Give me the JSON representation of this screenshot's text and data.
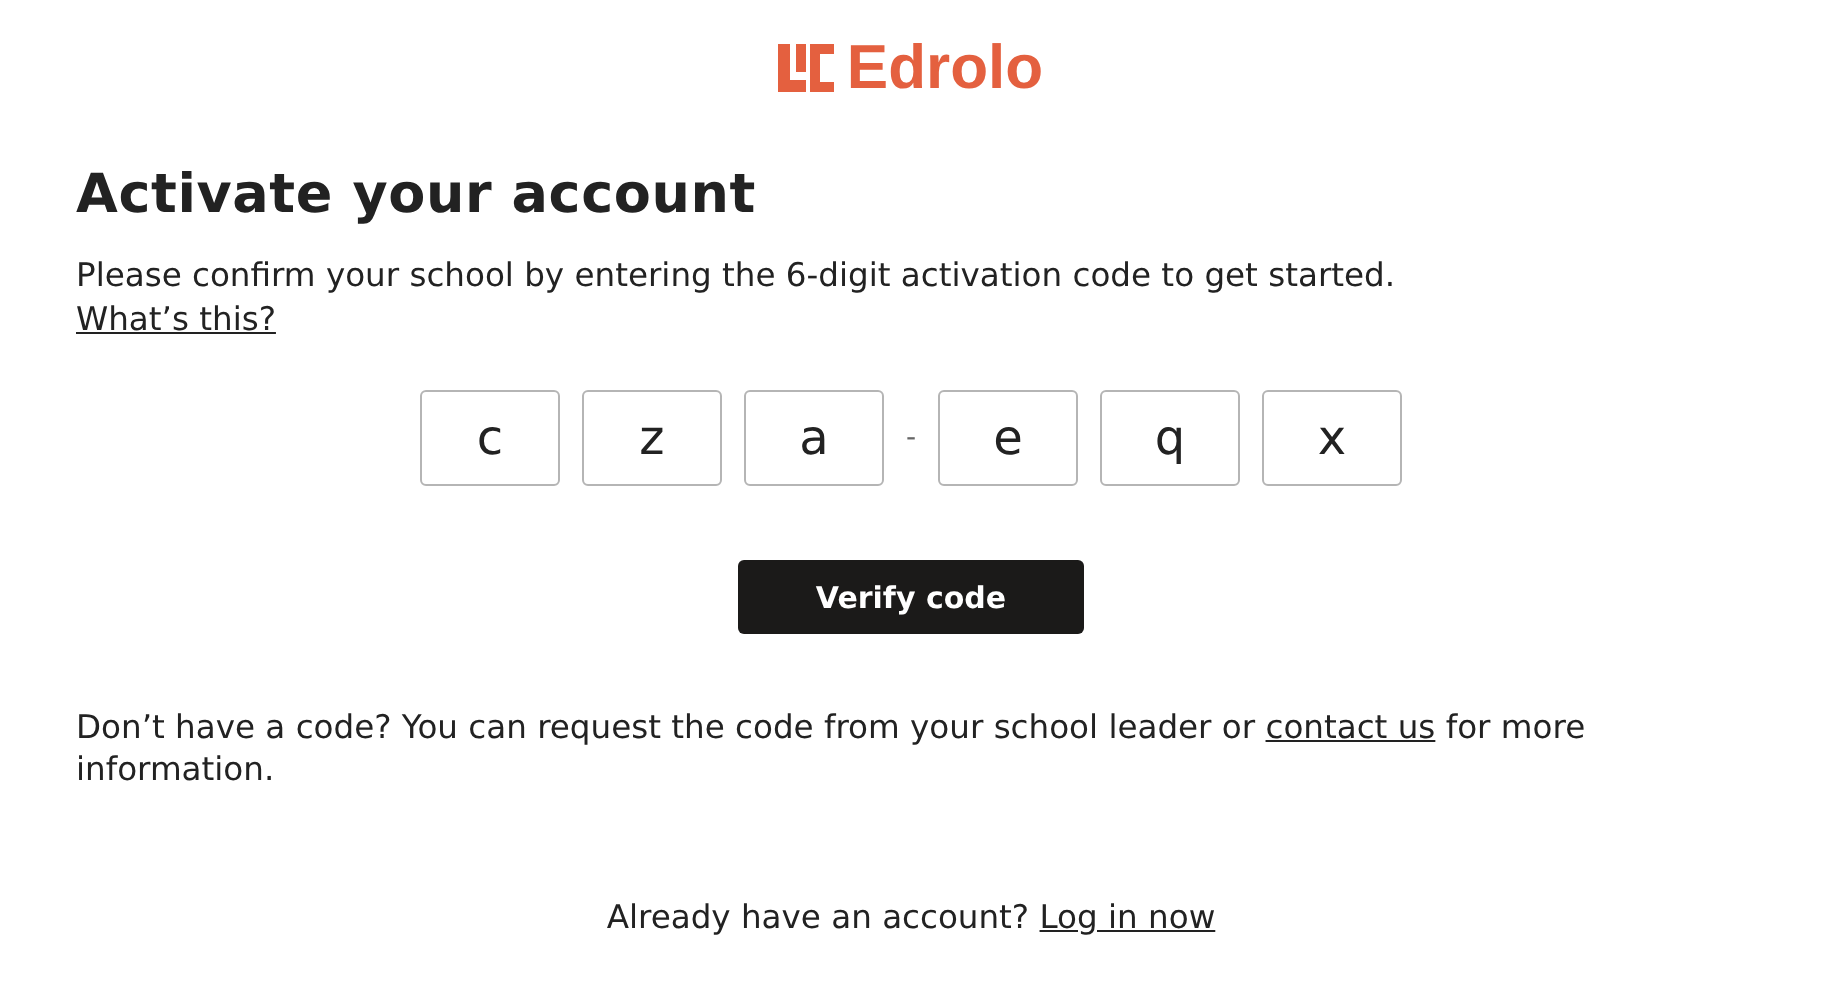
{
  "logo": {
    "text": "Edrolo"
  },
  "title": "Activate your account",
  "intro": "Please confirm your school by entering the 6-digit activation code to get started.",
  "help_link": "What’s this?",
  "code": {
    "groups": [
      [
        "c",
        "z",
        "a"
      ],
      [
        "e",
        "q",
        "x"
      ]
    ],
    "separator": "-"
  },
  "verify_button": "Verify code",
  "no_code": {
    "text": "Don’t have a code? You can request the code from your school leader or ",
    "link": "contact us",
    "after": " for more information."
  },
  "login": {
    "text": "Already have an account? ",
    "link": "Log in now"
  }
}
